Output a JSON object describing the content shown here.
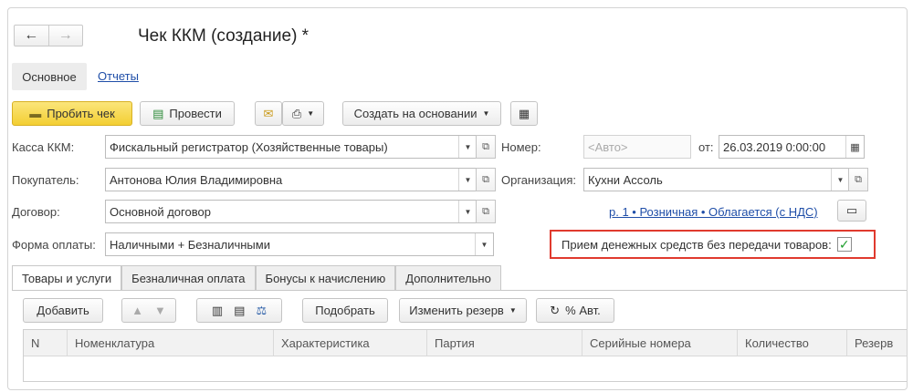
{
  "header": {
    "title": "Чек ККМ (создание) *"
  },
  "nav": {
    "back_icon": "arrow-left-icon",
    "forward_icon": "arrow-right-icon"
  },
  "tabs_top": {
    "main": "Основное",
    "reports": "Отчеты"
  },
  "toolbar": {
    "print_receipt": "Пробить чек",
    "post": "Провести",
    "create_based_on": "Создать на основании",
    "icons": [
      "cash-register-icon",
      "post-document-icon",
      "mail-icon",
      "printer-icon",
      "report-icon"
    ]
  },
  "form": {
    "kassa": {
      "label": "Касса ККМ:",
      "value": "Фискальный регистратор (Хозяйственные товары)"
    },
    "buyer": {
      "label": "Покупатель:",
      "value": "Антонова Юлия Владимировна"
    },
    "contract": {
      "label": "Договор:",
      "value": "Основной договор"
    },
    "payment": {
      "label": "Форма оплаты:",
      "value": "Наличными + Безналичными"
    },
    "number": {
      "label": "Номер:",
      "placeholder": "<Авто>"
    },
    "date": {
      "label": "от:",
      "value": "26.03.2019  0:00:00"
    },
    "org": {
      "label": "Организация:",
      "value": "Кухни Ассоль"
    },
    "tax_link": "р. 1 • Розничная • Облагается (с НДС)",
    "no_transfer": {
      "label": "Прием денежных средств без передачи товаров:",
      "checked": true
    }
  },
  "tabs": [
    "Товары и услуги",
    "Безналичная оплата",
    "Бонусы к начислению",
    "Дополнительно"
  ],
  "table_toolbar": {
    "add": "Добавить",
    "pick": "Подобрать",
    "change_reserve": "Изменить резерв",
    "auto_discount": "% Авт."
  },
  "table": {
    "columns": [
      "N",
      "Номенклатура",
      "Характеристика",
      "Партия",
      "Серийные номера",
      "Количество",
      "Резерв"
    ]
  },
  "colors": {
    "accent_yellow": "#f3cf33",
    "highlight_red": "#e03a2e",
    "link_blue": "#1f4ea8"
  }
}
